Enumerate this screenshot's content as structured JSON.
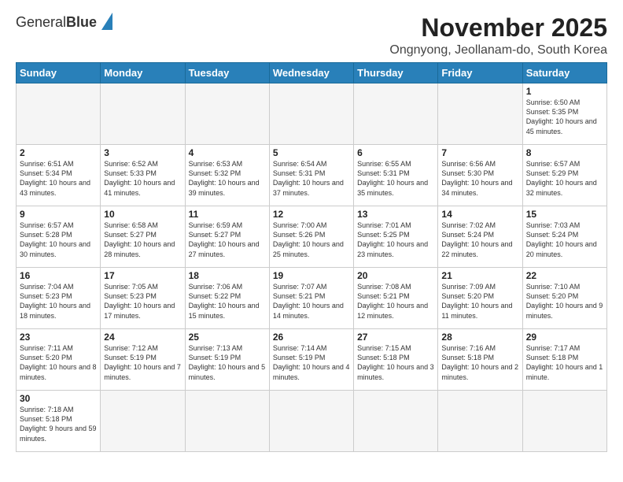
{
  "logo": {
    "text_normal": "General",
    "text_bold": "Blue"
  },
  "header": {
    "month_title": "November 2025",
    "location": "Ongnyong, Jeollanam-do, South Korea"
  },
  "days_of_week": [
    "Sunday",
    "Monday",
    "Tuesday",
    "Wednesday",
    "Thursday",
    "Friday",
    "Saturday"
  ],
  "weeks": [
    [
      {
        "day": "",
        "info": ""
      },
      {
        "day": "",
        "info": ""
      },
      {
        "day": "",
        "info": ""
      },
      {
        "day": "",
        "info": ""
      },
      {
        "day": "",
        "info": ""
      },
      {
        "day": "",
        "info": ""
      },
      {
        "day": "1",
        "info": "Sunrise: 6:50 AM\nSunset: 5:35 PM\nDaylight: 10 hours and 45 minutes."
      }
    ],
    [
      {
        "day": "2",
        "info": "Sunrise: 6:51 AM\nSunset: 5:34 PM\nDaylight: 10 hours and 43 minutes."
      },
      {
        "day": "3",
        "info": "Sunrise: 6:52 AM\nSunset: 5:33 PM\nDaylight: 10 hours and 41 minutes."
      },
      {
        "day": "4",
        "info": "Sunrise: 6:53 AM\nSunset: 5:32 PM\nDaylight: 10 hours and 39 minutes."
      },
      {
        "day": "5",
        "info": "Sunrise: 6:54 AM\nSunset: 5:31 PM\nDaylight: 10 hours and 37 minutes."
      },
      {
        "day": "6",
        "info": "Sunrise: 6:55 AM\nSunset: 5:31 PM\nDaylight: 10 hours and 35 minutes."
      },
      {
        "day": "7",
        "info": "Sunrise: 6:56 AM\nSunset: 5:30 PM\nDaylight: 10 hours and 34 minutes."
      },
      {
        "day": "8",
        "info": "Sunrise: 6:57 AM\nSunset: 5:29 PM\nDaylight: 10 hours and 32 minutes."
      }
    ],
    [
      {
        "day": "9",
        "info": "Sunrise: 6:57 AM\nSunset: 5:28 PM\nDaylight: 10 hours and 30 minutes."
      },
      {
        "day": "10",
        "info": "Sunrise: 6:58 AM\nSunset: 5:27 PM\nDaylight: 10 hours and 28 minutes."
      },
      {
        "day": "11",
        "info": "Sunrise: 6:59 AM\nSunset: 5:27 PM\nDaylight: 10 hours and 27 minutes."
      },
      {
        "day": "12",
        "info": "Sunrise: 7:00 AM\nSunset: 5:26 PM\nDaylight: 10 hours and 25 minutes."
      },
      {
        "day": "13",
        "info": "Sunrise: 7:01 AM\nSunset: 5:25 PM\nDaylight: 10 hours and 23 minutes."
      },
      {
        "day": "14",
        "info": "Sunrise: 7:02 AM\nSunset: 5:24 PM\nDaylight: 10 hours and 22 minutes."
      },
      {
        "day": "15",
        "info": "Sunrise: 7:03 AM\nSunset: 5:24 PM\nDaylight: 10 hours and 20 minutes."
      }
    ],
    [
      {
        "day": "16",
        "info": "Sunrise: 7:04 AM\nSunset: 5:23 PM\nDaylight: 10 hours and 18 minutes."
      },
      {
        "day": "17",
        "info": "Sunrise: 7:05 AM\nSunset: 5:23 PM\nDaylight: 10 hours and 17 minutes."
      },
      {
        "day": "18",
        "info": "Sunrise: 7:06 AM\nSunset: 5:22 PM\nDaylight: 10 hours and 15 minutes."
      },
      {
        "day": "19",
        "info": "Sunrise: 7:07 AM\nSunset: 5:21 PM\nDaylight: 10 hours and 14 minutes."
      },
      {
        "day": "20",
        "info": "Sunrise: 7:08 AM\nSunset: 5:21 PM\nDaylight: 10 hours and 12 minutes."
      },
      {
        "day": "21",
        "info": "Sunrise: 7:09 AM\nSunset: 5:20 PM\nDaylight: 10 hours and 11 minutes."
      },
      {
        "day": "22",
        "info": "Sunrise: 7:10 AM\nSunset: 5:20 PM\nDaylight: 10 hours and 9 minutes."
      }
    ],
    [
      {
        "day": "23",
        "info": "Sunrise: 7:11 AM\nSunset: 5:20 PM\nDaylight: 10 hours and 8 minutes."
      },
      {
        "day": "24",
        "info": "Sunrise: 7:12 AM\nSunset: 5:19 PM\nDaylight: 10 hours and 7 minutes."
      },
      {
        "day": "25",
        "info": "Sunrise: 7:13 AM\nSunset: 5:19 PM\nDaylight: 10 hours and 5 minutes."
      },
      {
        "day": "26",
        "info": "Sunrise: 7:14 AM\nSunset: 5:19 PM\nDaylight: 10 hours and 4 minutes."
      },
      {
        "day": "27",
        "info": "Sunrise: 7:15 AM\nSunset: 5:18 PM\nDaylight: 10 hours and 3 minutes."
      },
      {
        "day": "28",
        "info": "Sunrise: 7:16 AM\nSunset: 5:18 PM\nDaylight: 10 hours and 2 minutes."
      },
      {
        "day": "29",
        "info": "Sunrise: 7:17 AM\nSunset: 5:18 PM\nDaylight: 10 hours and 1 minute."
      }
    ],
    [
      {
        "day": "30",
        "info": "Sunrise: 7:18 AM\nSunset: 5:18 PM\nDaylight: 9 hours and 59 minutes."
      },
      {
        "day": "",
        "info": ""
      },
      {
        "day": "",
        "info": ""
      },
      {
        "day": "",
        "info": ""
      },
      {
        "day": "",
        "info": ""
      },
      {
        "day": "",
        "info": ""
      },
      {
        "day": "",
        "info": ""
      }
    ]
  ]
}
